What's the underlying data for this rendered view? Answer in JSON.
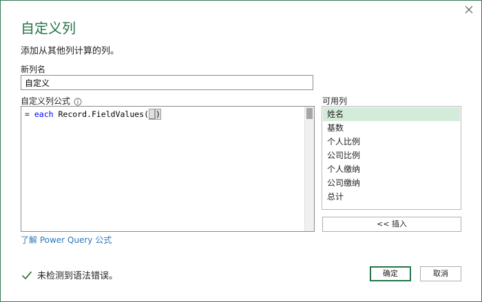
{
  "dialog": {
    "title": "自定义列",
    "subtitle": "添加从其他列计算的列。"
  },
  "new_column": {
    "label": "新列名",
    "value": "自定义"
  },
  "formula": {
    "label": "自定义列公式",
    "eq": "= ",
    "keyword": "each",
    "expr": " Record.FieldValues(",
    "cursor_char": "_",
    "close": ")"
  },
  "available_columns": {
    "label": "可用列",
    "items": [
      "姓名",
      "基数",
      "个人比例",
      "公司比例",
      "个人缴纳",
      "公司缴纳",
      "总计"
    ],
    "selected_index": 0,
    "insert_label": "<< 插入"
  },
  "learn_link": "了解 Power Query 公式",
  "status": {
    "text": "未检测到语法错误。",
    "color": "#3a7d44"
  },
  "buttons": {
    "ok": "确定",
    "cancel": "取消"
  },
  "colors": {
    "accent": "#217346",
    "selection": "#d3ecd9",
    "link": "#2e75b6"
  }
}
